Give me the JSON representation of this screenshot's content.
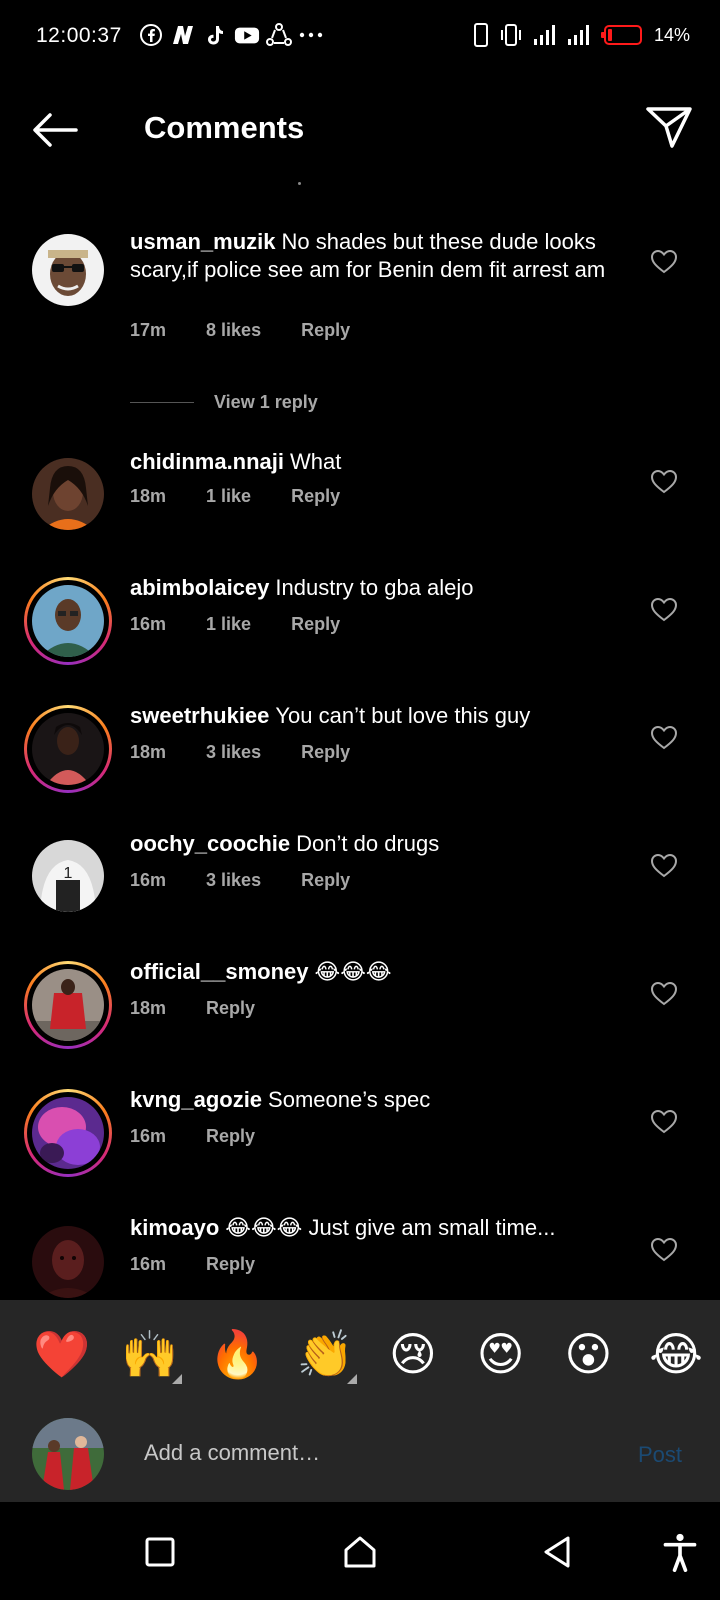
{
  "status": {
    "time": "12:00:37",
    "app_icons": [
      "facebook-icon",
      "n-app-icon",
      "tiktok-icon",
      "youtube-icon",
      "sync-icon",
      "more-dots-icon"
    ],
    "battery_percent": "14%",
    "battery_level": 0.14,
    "battery_color": "#ff1a1a"
  },
  "header": {
    "title": "Comments"
  },
  "comments": [
    {
      "user": "usman_muzik",
      "text": "No shades but these dude looks scary,if police see am for Benin dem fit arrest am",
      "time": "17m",
      "likes": "8 likes",
      "reply": "Reply",
      "story": false,
      "view_replies": "View 1 reply"
    },
    {
      "user": "chidinma.nnaji",
      "text": "What",
      "time": "18m",
      "likes": "1 like",
      "reply": "Reply",
      "story": false
    },
    {
      "user": "abimbolaicey",
      "text": "Industry to gba alejo",
      "time": "16m",
      "likes": "1 like",
      "reply": "Reply",
      "story": true
    },
    {
      "user": "sweetrhukiee",
      "text": "You can’t but love this guy",
      "time": "18m",
      "likes": "3 likes",
      "reply": "Reply",
      "story": true
    },
    {
      "user": "oochy_coochie",
      "text": "Don’t do drugs",
      "time": "16m",
      "likes": "3 likes",
      "reply": "Reply",
      "story": false
    },
    {
      "user": "official__smoney",
      "text": "😂😂😂",
      "time": "18m",
      "likes": "",
      "reply": "Reply",
      "story": true
    },
    {
      "user": "kvng_agozie",
      "text": "Someone’s spec",
      "time": "16m",
      "likes": "",
      "reply": "Reply",
      "story": true
    },
    {
      "user": "kimoayo",
      "text": "😂😂😂 Just give am small time...",
      "time": "16m",
      "likes": "",
      "reply": "Reply",
      "story": false
    }
  ],
  "emoji_bar": [
    "❤️",
    "🙌",
    "🔥",
    "👏",
    "😢",
    "😍",
    "😮",
    "😂"
  ],
  "composer": {
    "placeholder": "Add a comment…",
    "post_label": "Post"
  },
  "nav": [
    "recents-icon",
    "home-icon",
    "back-icon",
    "accessibility-icon"
  ]
}
